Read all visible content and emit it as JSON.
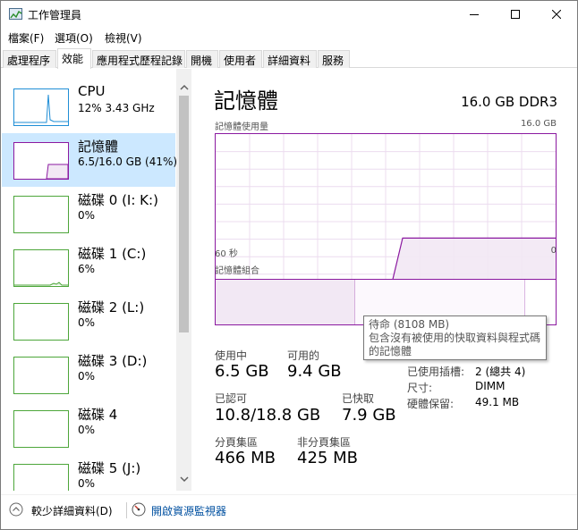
{
  "window": {
    "title": "工作管理員",
    "controls": {
      "minimize": "minimize-icon",
      "maximize": "maximize-icon",
      "close": "close-icon"
    }
  },
  "menu": [
    "檔案(F)",
    "選項(O)",
    "檢視(V)"
  ],
  "tabs": [
    {
      "label": "處理程序",
      "active": false
    },
    {
      "label": "效能",
      "active": true
    },
    {
      "label": "應用程式歷程記錄",
      "active": false
    },
    {
      "label": "開機",
      "active": false
    },
    {
      "label": "使用者",
      "active": false
    },
    {
      "label": "詳細資料",
      "active": false
    },
    {
      "label": "服務",
      "active": false
    }
  ],
  "sidebar": {
    "items": [
      {
        "name": "CPU",
        "sub": "12% 3.43 GHz",
        "kind": "cpu"
      },
      {
        "name": "記憶體",
        "sub": "6.5/16.0 GB (41%)",
        "kind": "mem",
        "selected": true
      },
      {
        "name": "磁碟 0 (I: K:)",
        "sub": "0%",
        "kind": "disk"
      },
      {
        "name": "磁碟 1 (C:)",
        "sub": "6%",
        "kind": "disk"
      },
      {
        "name": "磁碟 2 (L:)",
        "sub": "0%",
        "kind": "disk"
      },
      {
        "name": "磁碟 3 (D:)",
        "sub": "0%",
        "kind": "disk"
      },
      {
        "name": "磁碟 4",
        "sub": "0%",
        "kind": "disk"
      },
      {
        "name": "磁碟 5 (J:)",
        "sub": "0%",
        "kind": "disk"
      }
    ]
  },
  "detail": {
    "title": "記憶體",
    "spec": "16.0 GB DDR3",
    "usage_graph_label": "記憶體使用量",
    "usage_graph_max": "16.0 GB",
    "time_left": "60 秒",
    "time_right": "0",
    "composition_label": "記憶體組合",
    "stats": {
      "in_use_label": "使用中",
      "in_use_value": "6.5 GB",
      "available_label": "可用的",
      "available_value": "9.4 GB",
      "committed_label": "已認可",
      "committed_value": "10.8/18.8 GB",
      "cached_label": "已快取",
      "cached_value": "7.9 GB",
      "paged_label": "分頁集區",
      "paged_value": "466 MB",
      "nonpaged_label": "非分頁集區",
      "nonpaged_value": "425 MB"
    },
    "props": {
      "slots_label": "已使用插槽:",
      "slots_value": "2 (總共 4)",
      "form_label": "尺寸:",
      "form_value": "DIMM",
      "reserved_label": "硬體保留:",
      "reserved_value": "49.1 MB"
    },
    "tooltip": {
      "line1": "待命 (8108 MB)",
      "line2": "包含沒有被使用的快取資料與程式碼",
      "line3": "的記憶體"
    }
  },
  "chart_data": {
    "type": "area",
    "title": "記憶體使用量",
    "xlabel": "",
    "ylabel": "",
    "x": [
      60,
      30,
      27,
      0
    ],
    "series": [
      {
        "values": [
          0,
          0,
          6.5,
          6.5
        ]
      }
    ],
    "ylim": [
      0,
      16
    ],
    "grid": true
  },
  "composition": {
    "in_use_fraction": 0.41,
    "standby_fraction": 0.5,
    "free_fraction": 0.09
  },
  "footer": {
    "fewer_details": "較少詳細資料(D)",
    "open_monitor": "開啟資源監視器"
  },
  "colors": {
    "memory": "#8b19a0",
    "memory_fill": "#f2e8f4",
    "cpu": "#1f8ed6",
    "disk": "#4da63a",
    "selected": "#cce8ff"
  }
}
